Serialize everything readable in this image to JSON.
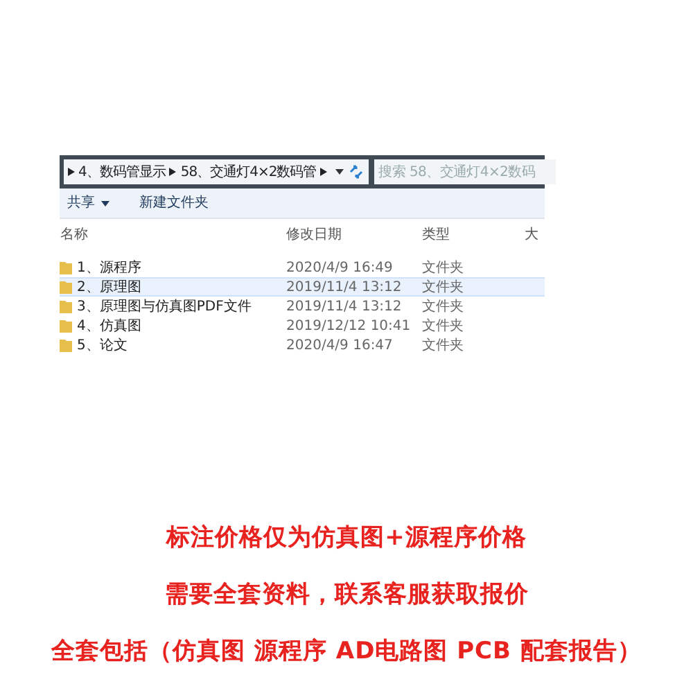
{
  "explorer": {
    "breadcrumb": [
      "4、数码管显示",
      "58、交通灯4×2数码管"
    ],
    "search": {
      "placeholder": "搜索 58、交通灯4×2数码"
    },
    "toolbar": [
      "共享",
      "新建文件夹"
    ],
    "columns": [
      "名称",
      "修改日期",
      "类型",
      "大"
    ],
    "rows": [
      {
        "name": "1、源程序",
        "date": "2020/4/9 16:49",
        "type": "文件夹",
        "selected": false
      },
      {
        "name": "2、原理图",
        "date": "2019/11/4 13:12",
        "type": "文件夹",
        "selected": true
      },
      {
        "name": "3、原理图与仿真图PDF文件",
        "date": "2019/11/4 13:12",
        "type": "文件夹",
        "selected": false
      },
      {
        "name": "4、仿真图",
        "date": "2019/12/12 10:41",
        "type": "文件夹",
        "selected": false
      },
      {
        "name": "5、论文",
        "date": "2020/4/9 16:47",
        "type": "文件夹",
        "selected": false
      }
    ]
  },
  "notes": [
    "标注价格仅为仿真图+源程序价格",
    "需要全套资料，联系客服获取报价",
    "全套包括（仿真图 源程序 AD电路图 PCB  配套报告）"
  ]
}
